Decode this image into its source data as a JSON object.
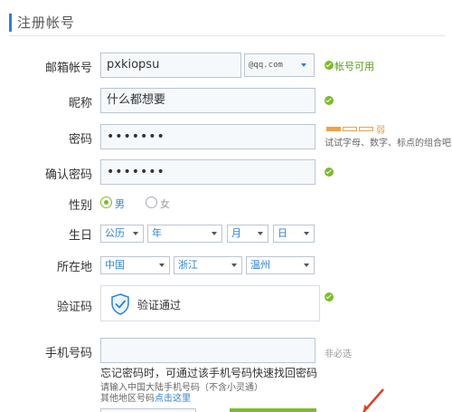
{
  "header": {
    "title": "注册帐号"
  },
  "email": {
    "label": "邮箱帐号",
    "value": "pxkiopsu",
    "domain": "@qq.com",
    "status": "帐号可用"
  },
  "nickname": {
    "label": "昵称",
    "value": "什么都想要"
  },
  "password": {
    "label": "密码",
    "value": "•••••••",
    "strength_level": "弱",
    "hint": "试试字母、数字、标点的组合吧"
  },
  "confirm": {
    "label": "确认密码",
    "value": "•••••••"
  },
  "gender": {
    "label": "性别",
    "male": "男",
    "female": "女"
  },
  "birthday": {
    "label": "生日",
    "calendar": "公历",
    "year": "年",
    "month": "月",
    "day": "日"
  },
  "location": {
    "label": "所在地",
    "country": "中国",
    "province": "浙江",
    "city": "温州"
  },
  "captcha": {
    "label": "验证码",
    "status": "验证通过"
  },
  "phone": {
    "label": "手机号码",
    "value": "",
    "note": "非必选",
    "info_line1": "忘记密码时，可通过该手机号码快速找回密码",
    "info_line2": "请输入中国大陆手机号码（不含小灵通）",
    "info_line3_prefix": "其他地区号码",
    "info_link": "点击这里"
  },
  "colors": {
    "accent": "#2d82d2",
    "ok": "#7cbb2c",
    "warn": "#f0a04a"
  },
  "icons": [
    "check-circle-icon",
    "shield-check-icon",
    "chevron-down-icon",
    "radio-icon",
    "cursor-arrow-icon"
  ]
}
